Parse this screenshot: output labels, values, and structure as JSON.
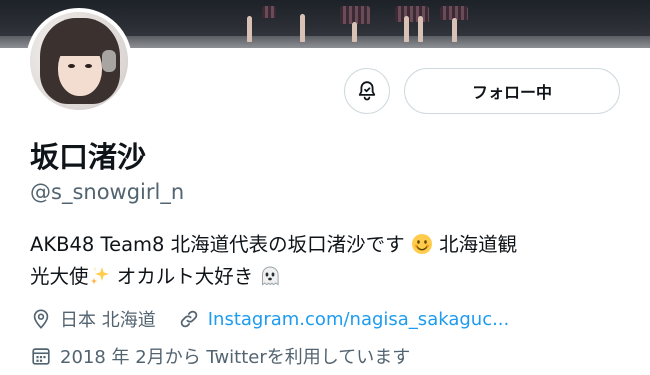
{
  "profile": {
    "display_name": "坂口渚沙",
    "handle": "@s_snowgirl_n",
    "bio_line1": "AKB48 Team8 北海道代表の坂口渚沙です",
    "bio_line1_tail": "北海道観",
    "bio_line2": "光大使",
    "bio_line2_tail": "オカルト大好き",
    "location": "日本 北海道",
    "website": "Instagram.com/nagisa_sakaguc...",
    "joined": "2018 年 2月から Twitterを利用しています"
  },
  "actions": {
    "follow_label": "フォロー中",
    "notification_icon": "bell-icon"
  },
  "icons": {
    "location": "location-pin-icon",
    "link": "link-icon",
    "calendar": "calendar-icon",
    "emoji_smile": "smiling-face-emoji",
    "emoji_sparkles": "sparkles-emoji",
    "emoji_ghost": "ghost-emoji"
  },
  "colors": {
    "link": "#1d9bf0",
    "secondary_text": "#536471",
    "primary_text": "#0f1419",
    "border": "#cfd9de"
  }
}
